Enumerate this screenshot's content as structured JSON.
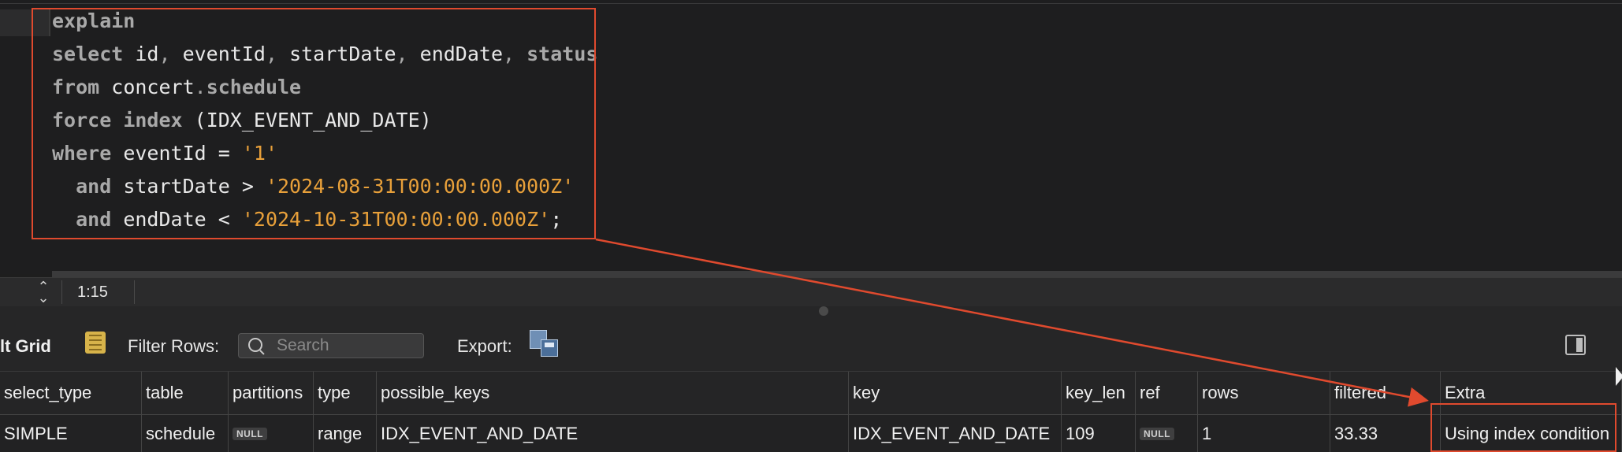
{
  "editor": {
    "lines": [
      [
        {
          "t": "explain",
          "c": "kw"
        }
      ],
      [
        {
          "t": "select",
          "c": "kw"
        },
        {
          "t": " id",
          "c": "ident"
        },
        {
          "t": ",",
          "c": "pt"
        },
        {
          "t": " eventId",
          "c": "ident"
        },
        {
          "t": ",",
          "c": "pt"
        },
        {
          "t": " startDate",
          "c": "ident"
        },
        {
          "t": ",",
          "c": "pt"
        },
        {
          "t": " endDate",
          "c": "ident"
        },
        {
          "t": ",",
          "c": "pt"
        },
        {
          "t": " status",
          "c": "kw"
        }
      ],
      [
        {
          "t": "from",
          "c": "kw"
        },
        {
          "t": " concert",
          "c": "ident"
        },
        {
          "t": ".",
          "c": "pt"
        },
        {
          "t": "schedule",
          "c": "kw"
        }
      ],
      [
        {
          "t": "force",
          "c": "kw"
        },
        {
          "t": " ",
          "c": "ident"
        },
        {
          "t": "index",
          "c": "kw"
        },
        {
          "t": " (IDX_EVENT_AND_DATE)",
          "c": "ident"
        }
      ],
      [
        {
          "t": "where",
          "c": "kw"
        },
        {
          "t": " eventId = ",
          "c": "ident"
        },
        {
          "t": "'1'",
          "c": "str"
        }
      ],
      [
        {
          "t": "  ",
          "c": "ident"
        },
        {
          "t": "and",
          "c": "kw"
        },
        {
          "t": " startDate > ",
          "c": "ident"
        },
        {
          "t": "'2024-08-31T00:00:00.000Z'",
          "c": "str"
        }
      ],
      [
        {
          "t": "  ",
          "c": "ident"
        },
        {
          "t": "and",
          "c": "kw"
        },
        {
          "t": " endDate < ",
          "c": "ident"
        },
        {
          "t": "'2024-10-31T00:00:00.000Z'",
          "c": "str"
        },
        {
          "t": ";",
          "c": "ident"
        }
      ]
    ]
  },
  "status": {
    "cursor_position": "1:15"
  },
  "toolbar": {
    "grid_label": "lt Grid",
    "filter_label": "Filter Rows:",
    "search_placeholder": "Search",
    "export_label": "Export:"
  },
  "grid": {
    "columns": [
      "select_type",
      "table",
      "partitions",
      "type",
      "possible_keys",
      "key",
      "key_len",
      "ref",
      "rows",
      "filtered",
      "Extra"
    ],
    "rows": [
      [
        "SIMPLE",
        "schedule",
        "NULL",
        "range",
        "IDX_EVENT_AND_DATE",
        "IDX_EVENT_AND_DATE",
        "109",
        "NULL",
        "1",
        "33.33",
        "Using index condition"
      ]
    ]
  },
  "colors": {
    "highlight": "#e04a2e",
    "keyword": "#a9a9a9",
    "string": "#e8a03a"
  }
}
